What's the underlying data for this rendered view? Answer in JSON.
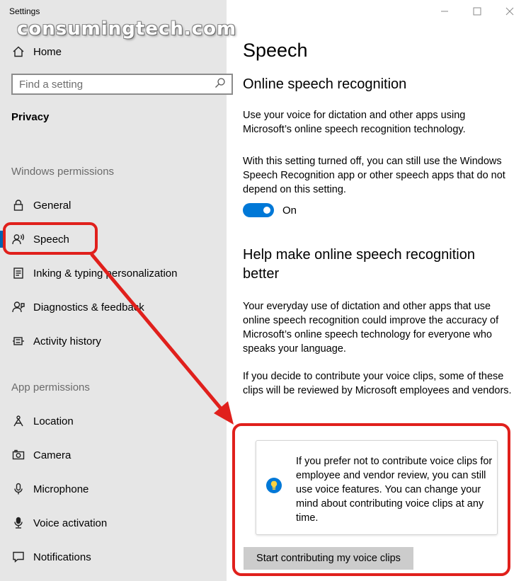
{
  "window": {
    "title": "Settings",
    "watermark": "consumingtech.com"
  },
  "sidebar": {
    "home_label": "Home",
    "search_placeholder": "Find a setting",
    "category": "Privacy",
    "windows_permissions_title": "Windows permissions",
    "windows_items": [
      {
        "label": "General",
        "icon": "lock-icon"
      },
      {
        "label": "Speech",
        "icon": "speech-icon",
        "selected": true
      },
      {
        "label": "Inking & typing personalization",
        "icon": "inking-icon"
      },
      {
        "label": "Diagnostics & feedback",
        "icon": "diagnostics-icon"
      },
      {
        "label": "Activity history",
        "icon": "activity-history-icon"
      }
    ],
    "app_permissions_title": "App permissions",
    "app_items": [
      {
        "label": "Location",
        "icon": "location-icon"
      },
      {
        "label": "Camera",
        "icon": "camera-icon"
      },
      {
        "label": "Microphone",
        "icon": "microphone-icon"
      },
      {
        "label": "Voice activation",
        "icon": "voice-activation-icon"
      },
      {
        "label": "Notifications",
        "icon": "notifications-icon"
      }
    ]
  },
  "main": {
    "title": "Speech",
    "online_section": {
      "heading": "Online speech recognition",
      "para1": "Use your voice for dictation and other apps using Microsoft’s online speech recognition technology.",
      "para2": "With this setting turned off, you can still use the Windows Speech Recognition app or other speech apps that do not depend on this setting.",
      "toggle_state": "On",
      "toggle_on": true
    },
    "help_section": {
      "heading": "Help make online speech recognition better",
      "para1": "Your everyday use of dictation and other apps that use online speech recognition could improve the accuracy of Microsoft’s online speech technology for everyone who speaks your language.",
      "para2": "If you decide to contribute your voice clips, some of these clips will be reviewed by Microsoft employees and vendors.",
      "info_text": "If you prefer not to contribute voice clips for employee and vendor review, you can still use voice features.  You can change your mind about contributing voice clips at any time.",
      "contribute_button": "Start contributing my voice clips"
    }
  },
  "colors": {
    "sidebar_bg": "#e6e6e6",
    "accent": "#0078d7",
    "annotation_red": "#e0201c"
  }
}
